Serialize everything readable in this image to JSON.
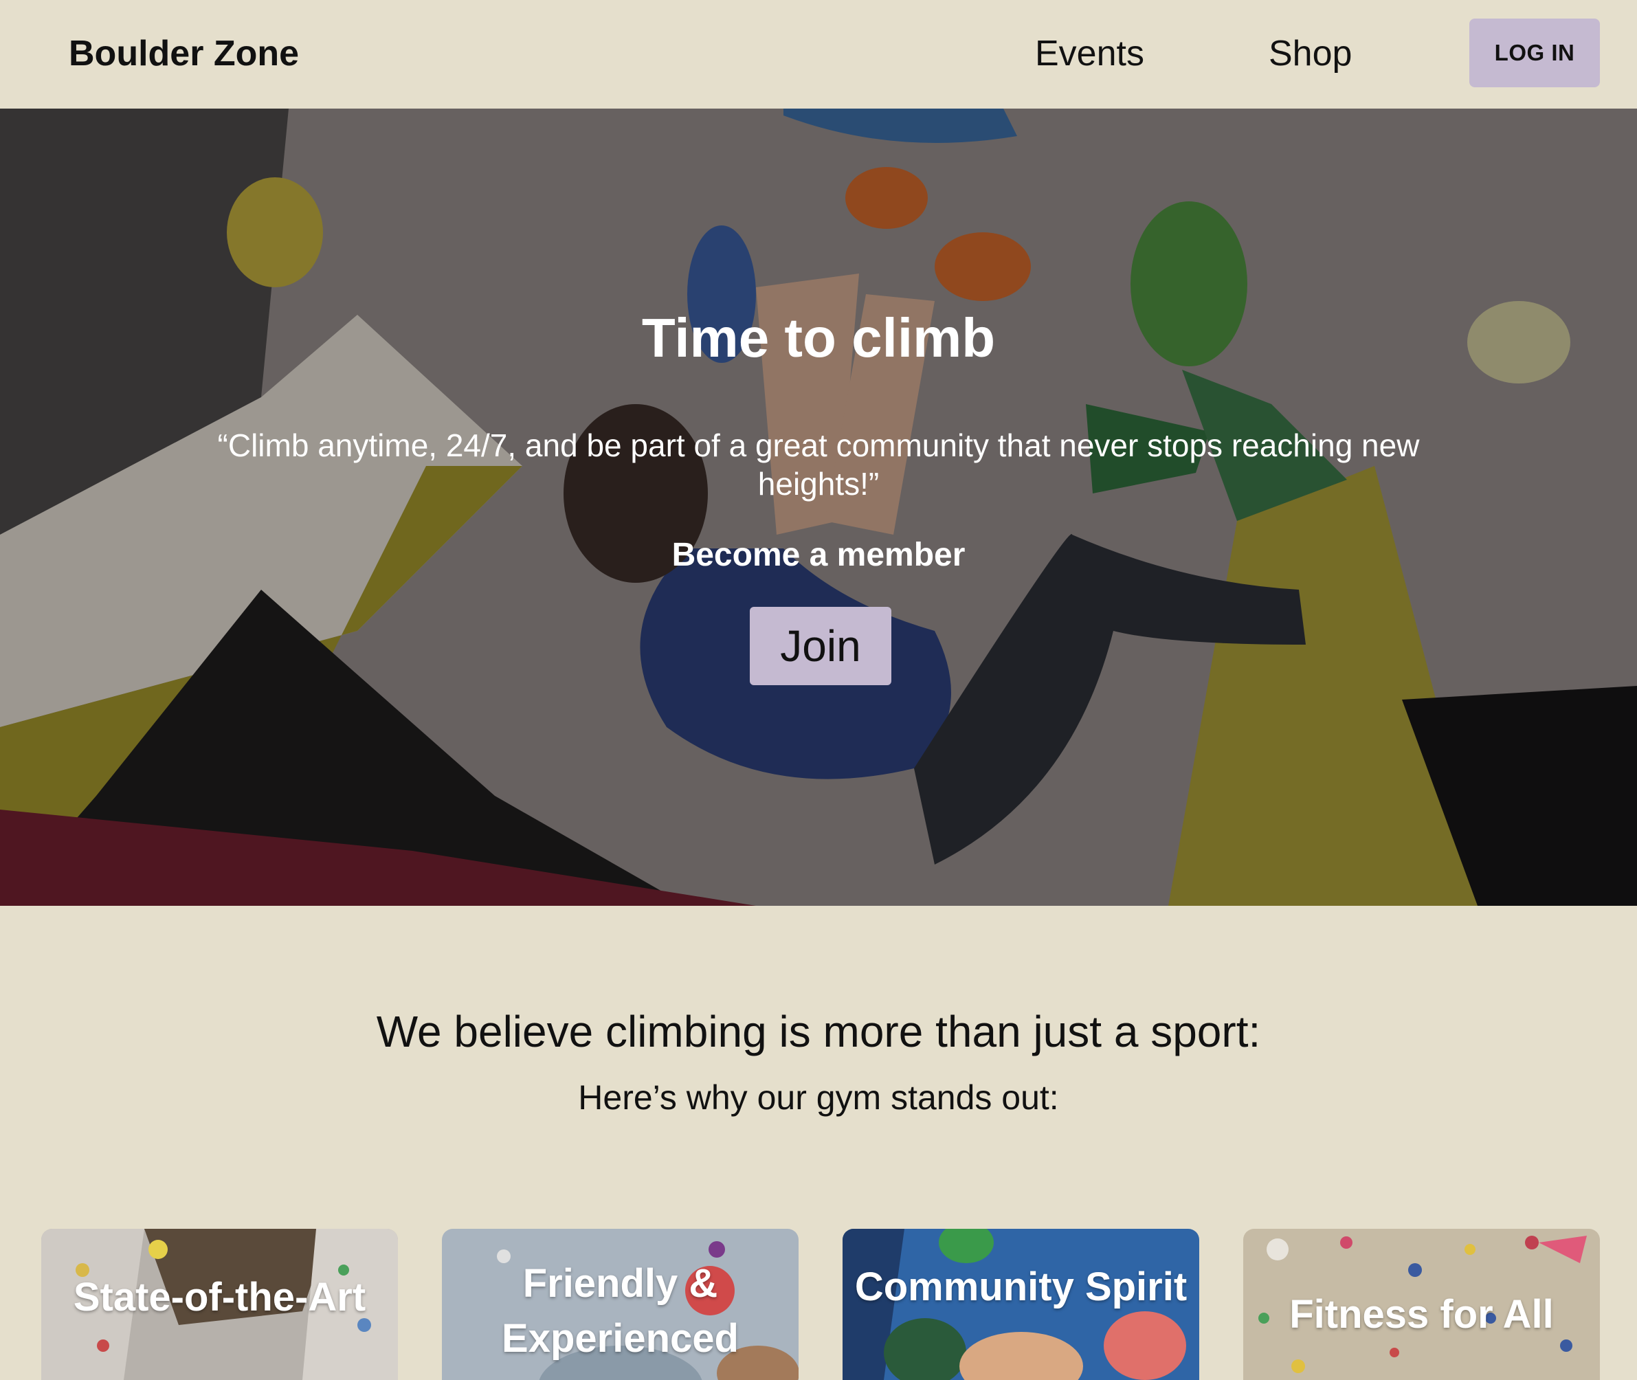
{
  "nav": {
    "brand": "Boulder Zone",
    "links": [
      "Events",
      "Shop"
    ],
    "login_label": "LOG IN"
  },
  "hero": {
    "title": "Time to climb",
    "quote": "“Climb anytime, 24/7, and be part of a great community that never stops reaching new heights!”",
    "member_text": "Become a member",
    "join_label": "Join"
  },
  "intro": {
    "title": "We believe climbing is more than just a sport:",
    "subtitle": "Here’s why our gym stands out:"
  },
  "cards": [
    {
      "title": "State-of-the-Art"
    },
    {
      "title": "Friendly & Experienced"
    },
    {
      "title": "Community Spirit"
    },
    {
      "title": "Fitness for All"
    }
  ],
  "colors": {
    "page_bg": "#e5dfcc",
    "button_bg": "#c5bad1",
    "text": "#111111"
  }
}
